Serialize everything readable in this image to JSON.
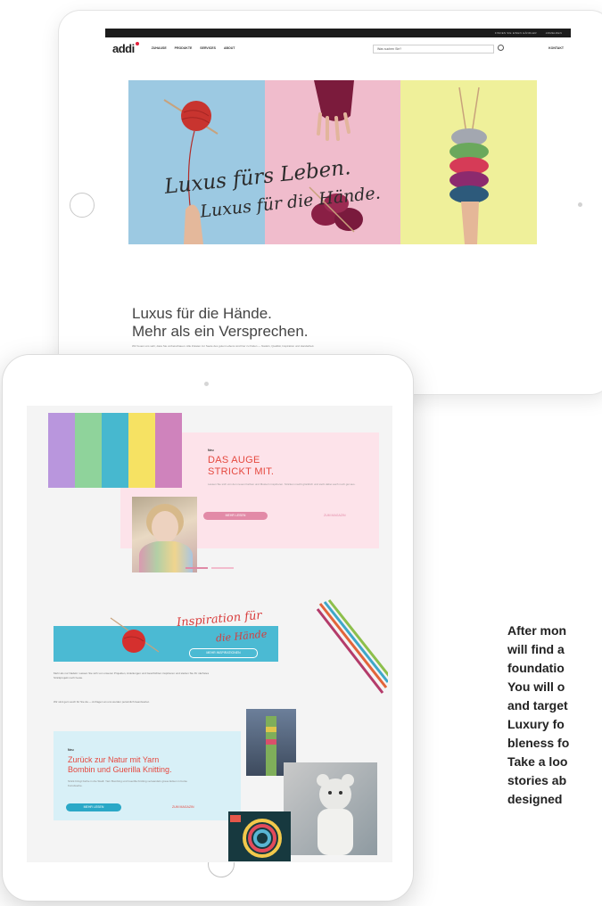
{
  "landscape": {
    "top_bar": [
      "FINDEN SIE EINEN HÄNDLER",
      "ANMELDEN"
    ],
    "logo": "addi",
    "nav": [
      "ZUHAUSE",
      "PRODUKTE",
      "SERVICES",
      "ABOUT"
    ],
    "search_placeholder": "Was suchen Sie?",
    "contact": "KONTAKT",
    "hero_script_line1": "Luxus fürs Leben.",
    "hero_script_line2": "Luxus für die Hände.",
    "headline_line1": "Luxus für die Hände.",
    "headline_line2": "Mehr als ein Versprechen.",
    "intro_text": "Wir freuen uns sehr, dass Sie vorbeischauen. Alle Zutaten zur Seele des guten Lebens sind hier zu finden — Nadeln, Qualität, Inspiration und Handarbeit."
  },
  "portrait": {
    "auge_eyebrow": "Neu",
    "auge_title_line1": "DAS AUGE",
    "auge_title_line2": "STRICKT MIT.",
    "auge_text": "Lassen Sie sich von den neuen Farben und Mustern inspirieren. Stricken macht glücklich und sieht dabei auch noch gut aus.",
    "auge_button": "MEHR LESEN",
    "auge_link": "ZUM MAGAZIN",
    "inspiration_line1": "Inspiration für",
    "inspiration_line2": "die Hände",
    "inspiration_button": "MEHR INSPIRATIONEN",
    "inspiration_text": "Mehr als nur Nadeln: Lassen Sie sich von unseren Projekten, Anleitungen und Geschichten inspirieren und starten Sie Ihr nächstes Strickprojekt noch heute.",
    "inspiration_text2": "Wir sind gern auch für Sie da — Anfragen an uns werden persönlich beantwortet.",
    "nature_eyebrow": "Neu",
    "nature_title_line1": "Zurück zur Natur mit Yarn",
    "nature_title_line2": "Bombin und Guerilla Knitting.",
    "nature_text": "Strick bringt Farbe in die Stadt: Yarn Bombing und Guerilla Knitting verwandeln graue Ecken in bunte Kunstwerke.",
    "nature_button": "MEHR LESEN",
    "nature_link": "ZUM MAGAZIN"
  },
  "caption_lines": [
    "After mon",
    "will find a",
    "foundatio",
    "You will o",
    "and target",
    "Luxury fo",
    "bleness fo",
    "Take a loo",
    "stories ab",
    "designed"
  ],
  "colors": {
    "stripes": [
      "#b996dd",
      "#8fd39b",
      "#47b8cf",
      "#f6e263",
      "#cf83bc"
    ],
    "accent_red": "#e5483f",
    "pink_button": "#e28aa7",
    "teal_button": "#2aa8c7"
  }
}
